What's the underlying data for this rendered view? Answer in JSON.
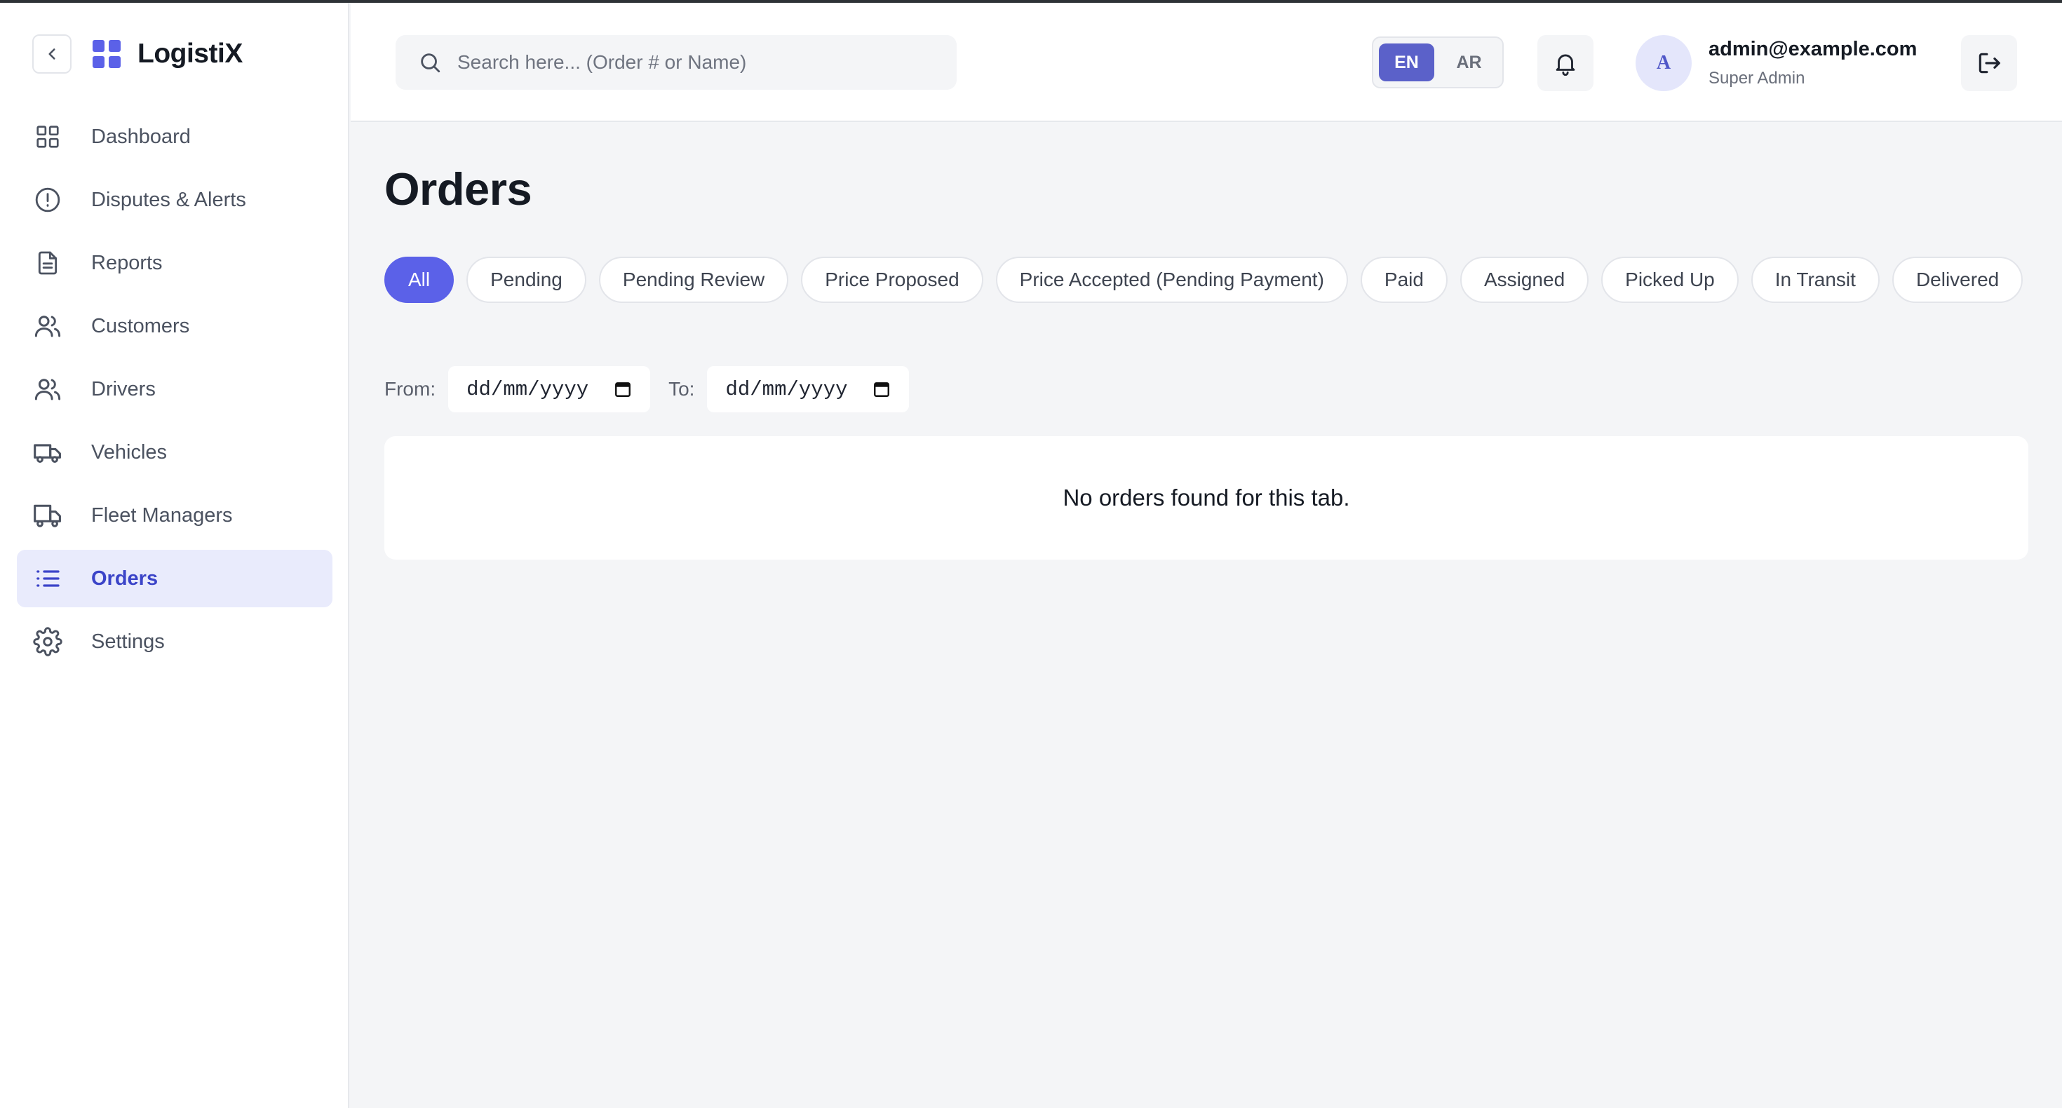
{
  "app": {
    "name": "LogistiX",
    "accent": "#5b61e8"
  },
  "sidebar": {
    "items": [
      {
        "label": "Dashboard",
        "icon": "grid-icon"
      },
      {
        "label": "Disputes & Alerts",
        "icon": "alert-circle-icon"
      },
      {
        "label": "Reports",
        "icon": "document-icon"
      },
      {
        "label": "Customers",
        "icon": "users-icon"
      },
      {
        "label": "Drivers",
        "icon": "users-icon"
      },
      {
        "label": "Vehicles",
        "icon": "truck-icon"
      },
      {
        "label": "Fleet Managers",
        "icon": "truck-icon"
      },
      {
        "label": "Orders",
        "icon": "list-icon",
        "active": true
      },
      {
        "label": "Settings",
        "icon": "gear-icon"
      }
    ]
  },
  "header": {
    "search_placeholder": "Search here... (Order # or Name)",
    "lang": {
      "en": "EN",
      "ar": "AR",
      "selected": "EN"
    },
    "user": {
      "avatar_initial": "A",
      "email": "admin@example.com",
      "role": "Super Admin"
    }
  },
  "main": {
    "title": "Orders",
    "tabs": [
      {
        "label": "All"
      },
      {
        "label": "Pending"
      },
      {
        "label": "Pending Review"
      },
      {
        "label": "Price Proposed"
      },
      {
        "label": "Price Accepted (Pending Payment)"
      },
      {
        "label": "Paid"
      },
      {
        "label": "Assigned"
      },
      {
        "label": "Picked Up"
      },
      {
        "label": "In Transit"
      },
      {
        "label": "Delivered"
      },
      {
        "label": ""
      }
    ],
    "date_filter": {
      "from_label": "From:",
      "to_label": "To:",
      "from_value": "dd/mm/yyyy",
      "to_value": "dd/mm/yyyy"
    },
    "empty_message": "No orders found for this tab."
  }
}
